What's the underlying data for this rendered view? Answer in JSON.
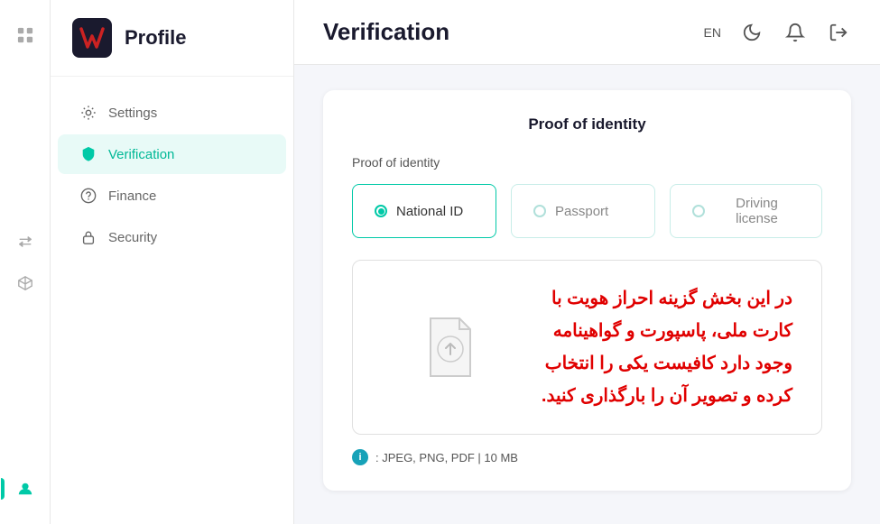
{
  "sidebar": {
    "logo_alt": "W Logo",
    "title": "Profile",
    "nav_items": [
      {
        "id": "settings",
        "label": "Settings",
        "icon": "gear",
        "active": false
      },
      {
        "id": "verification",
        "label": "Verification",
        "icon": "shield",
        "active": true
      },
      {
        "id": "finance",
        "label": "Finance",
        "icon": "coin",
        "active": false
      },
      {
        "id": "security",
        "label": "Security",
        "icon": "lock",
        "active": false
      }
    ]
  },
  "strip_icons": [
    {
      "id": "grid",
      "icon": "⊞",
      "active": false
    },
    {
      "id": "bell",
      "icon": "🔔",
      "active": false
    },
    {
      "id": "transfer",
      "icon": "⇄",
      "active": false
    },
    {
      "id": "cube",
      "icon": "⬡",
      "active": false
    },
    {
      "id": "user",
      "icon": "👤",
      "active": true
    }
  ],
  "topbar": {
    "title": "Verification",
    "lang": "EN",
    "icons": [
      "moon",
      "bell",
      "logout"
    ]
  },
  "card": {
    "title": "Proof of identity",
    "section_label": "Proof of identity",
    "id_types": [
      {
        "id": "national_id",
        "label": "National ID",
        "active": true
      },
      {
        "id": "passport",
        "label": "Passport",
        "active": false
      },
      {
        "id": "driving_license",
        "label": "Driving license",
        "active": false
      }
    ],
    "upload_text": "در این بخش گزینه احراز هویت با کارت ملی، پاسپورت و گواهینامه وجود دارد کافیست یکی را انتخاب کرده و تصویر آن را بارگذاری کنید.",
    "file_info": ": JPEG, PNG, PDF | 10 MB"
  }
}
